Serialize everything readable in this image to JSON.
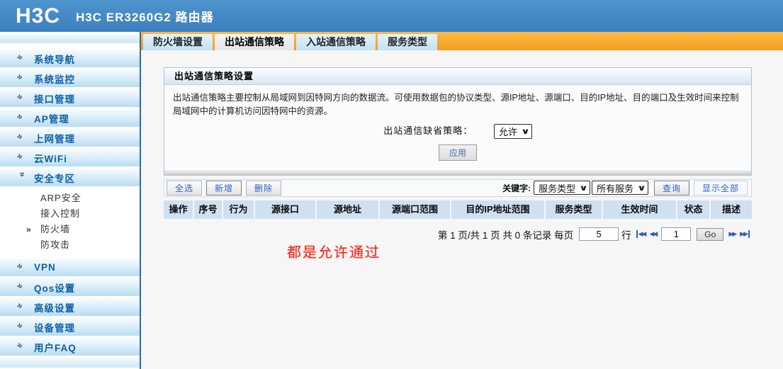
{
  "header": {
    "logo": "H3C",
    "title": "H3C ER3260G2 路由器"
  },
  "sidebar": {
    "items": [
      {
        "label": "系统导航",
        "expanded": false
      },
      {
        "label": "系统监控",
        "expanded": false
      },
      {
        "label": "接口管理",
        "expanded": false
      },
      {
        "label": "AP管理",
        "expanded": false
      },
      {
        "label": "上网管理",
        "expanded": false
      },
      {
        "label": "云WiFi",
        "expanded": false
      },
      {
        "label": "安全专区",
        "expanded": true
      },
      {
        "label": "VPN",
        "expanded": false
      },
      {
        "label": "Qos设置",
        "expanded": false
      },
      {
        "label": "高级设置",
        "expanded": false
      },
      {
        "label": "设备管理",
        "expanded": false
      },
      {
        "label": "用户FAQ",
        "expanded": false
      }
    ],
    "submenu": [
      {
        "label": "ARP安全",
        "active": false
      },
      {
        "label": "接入控制",
        "active": false
      },
      {
        "label": "防火墙",
        "active": true
      },
      {
        "label": "防攻击",
        "active": false
      }
    ]
  },
  "tabs": [
    {
      "label": "防火墙设置",
      "active": false
    },
    {
      "label": "出站通信策略",
      "active": true
    },
    {
      "label": "入站通信策略",
      "active": false
    },
    {
      "label": "服务类型",
      "active": false
    }
  ],
  "panel": {
    "title": "出站通信策略设置",
    "description": "出站通信策略主要控制从局域网到因特网方向的数据流。可使用数据包的协议类型、源IP地址、源端口、目的IP地址、目的端口及生效时间来控制局域网中的计算机访问因特网中的资源。",
    "default_policy_label": "出站通信缺省策略：",
    "default_policy_value": "允许",
    "apply_label": "应用"
  },
  "toolbar": {
    "select_all": "全选",
    "add": "新增",
    "delete": "删除",
    "keyword_label": "关键字:",
    "filter_field": "服务类型",
    "filter_value": "所有服务",
    "search": "查询",
    "show_all": "显示全部"
  },
  "table": {
    "columns": [
      "操作",
      "序号",
      "行为",
      "源接口",
      "源地址",
      "源端口范围",
      "目的IP地址范围",
      "服务类型",
      "生效时间",
      "状态",
      "描述"
    ]
  },
  "pagination": {
    "page_info": "第 1 页/共 1 页 共 0 条记录 每页",
    "rows_per_page": "5",
    "rows_suffix": "行",
    "current_page": "1",
    "go_label": "Go",
    "icons": {
      "first": "◀◀",
      "prev": "◀◀",
      "next": "▶▶",
      "last": "▶▶"
    }
  },
  "annotation": {
    "text": "都是允许通过"
  },
  "icons": {
    "chevron_down": "∨",
    "menu_arrow": "»",
    "submenu_arrow": "»"
  },
  "colors": {
    "header_blue": "#4189c6",
    "tab_orange": "#f8a82f",
    "sidebar_text_blue": "#0d5fa8",
    "table_header_bg": "#cfe0f1",
    "link_blue": "#2a62c9",
    "annotation_red": "#fb271a",
    "content_border_blue": "#2a6ab1"
  }
}
